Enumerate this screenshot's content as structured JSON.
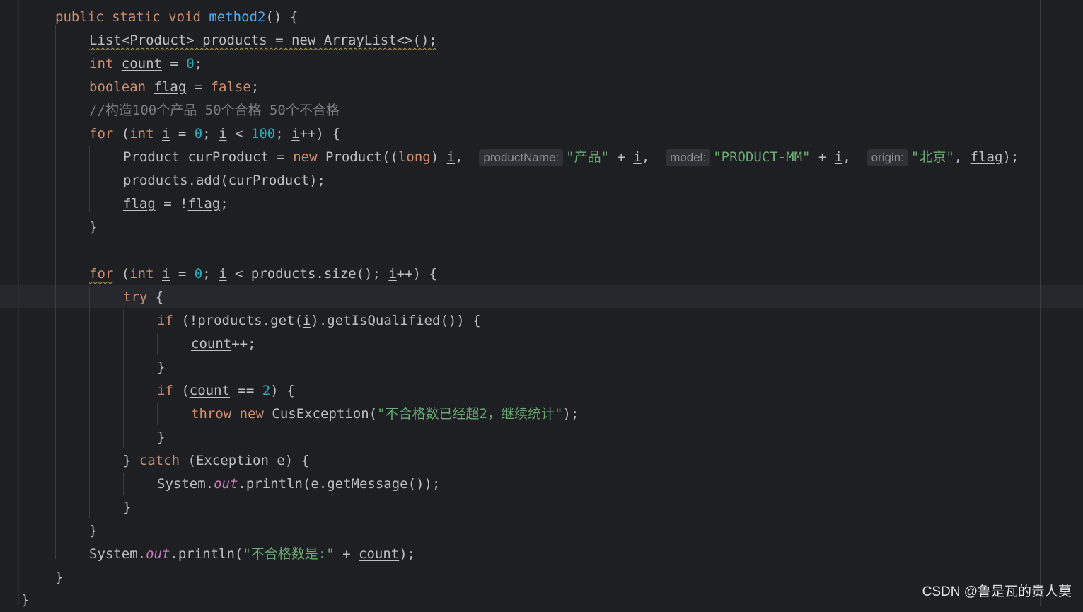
{
  "editor": {
    "lines": [
      {
        "t": [
          [
            "kw",
            "public static void "
          ],
          [
            "fn",
            "method2"
          ],
          [
            "",
            "() {"
          ]
        ]
      },
      {
        "t": [
          [
            "warn",
            "List<Product> products = new ArrayList<>();"
          ]
        ]
      },
      {
        "t": [
          [
            "kw",
            "int "
          ],
          [
            "var-mut",
            "count"
          ],
          [
            "",
            " = "
          ],
          [
            "num",
            "0"
          ],
          [
            "",
            ";"
          ]
        ]
      },
      {
        "t": [
          [
            "kw",
            "boolean "
          ],
          [
            "var-mut",
            "flag"
          ],
          [
            "",
            " = "
          ],
          [
            "kw",
            "false"
          ],
          [
            "",
            ";"
          ]
        ]
      },
      {
        "t": [
          [
            "cmt",
            "//构造100个产品 50个合格 50个不合格"
          ]
        ]
      },
      {
        "t": [
          [
            "kw",
            "for "
          ],
          [
            "",
            "("
          ],
          [
            "kw",
            "int "
          ],
          [
            "var-mut",
            "i"
          ],
          [
            "",
            " = "
          ],
          [
            "num",
            "0"
          ],
          [
            "",
            "; "
          ],
          [
            "var-mut",
            "i"
          ],
          [
            "",
            " < "
          ],
          [
            "num",
            "100"
          ],
          [
            "",
            "; "
          ],
          [
            "var-mut",
            "i"
          ],
          [
            "",
            "++) {"
          ]
        ]
      },
      {
        "t": [
          [
            "",
            "Product curProduct = "
          ],
          [
            "kw",
            "new "
          ],
          [
            "",
            "Product(("
          ],
          [
            "kw",
            "long"
          ],
          [
            "",
            ") "
          ],
          [
            "var-mut",
            "i"
          ],
          [
            "",
            ",  "
          ],
          [
            "hint",
            "productName:"
          ],
          [
            "str",
            "\"产品\""
          ],
          [
            "",
            " + "
          ],
          [
            "var-mut",
            "i"
          ],
          [
            "",
            ",  "
          ],
          [
            "hint",
            "model:"
          ],
          [
            "str",
            "\"PRODUCT-MM\""
          ],
          [
            "",
            " + "
          ],
          [
            "var-mut",
            "i"
          ],
          [
            "",
            ",  "
          ],
          [
            "hint",
            "origin:"
          ],
          [
            "str",
            "\"北京\""
          ],
          [
            "",
            ", "
          ],
          [
            "var-mut",
            "flag"
          ],
          [
            "",
            ");"
          ]
        ]
      },
      {
        "t": [
          [
            "",
            "products.add(curProduct);"
          ]
        ]
      },
      {
        "t": [
          [
            "var-mut",
            "flag"
          ],
          [
            "",
            " = !"
          ],
          [
            "var-mut",
            "flag"
          ],
          [
            "",
            ";"
          ]
        ]
      },
      {
        "t": [
          [
            "",
            "}"
          ]
        ]
      },
      {
        "t": []
      },
      {
        "t": [
          [
            "kw warn",
            "for"
          ],
          [
            "",
            " ("
          ],
          [
            "kw",
            "int "
          ],
          [
            "var-mut",
            "i"
          ],
          [
            "",
            " = "
          ],
          [
            "num",
            "0"
          ],
          [
            "",
            "; "
          ],
          [
            "var-mut",
            "i"
          ],
          [
            "",
            " < products.size(); "
          ],
          [
            "var-mut",
            "i"
          ],
          [
            "",
            "++) {"
          ]
        ]
      },
      {
        "t": [
          [
            "kw",
            "try "
          ],
          [
            "",
            "{"
          ]
        ]
      },
      {
        "t": [
          [
            "kw",
            "if "
          ],
          [
            "",
            "(!products.get("
          ],
          [
            "var-mut",
            "i"
          ],
          [
            "",
            ").getIsQualified()) {"
          ]
        ]
      },
      {
        "t": [
          [
            "var-mut",
            "count"
          ],
          [
            "",
            "++;"
          ]
        ]
      },
      {
        "t": [
          [
            "",
            "}"
          ]
        ]
      },
      {
        "t": [
          [
            "kw",
            "if "
          ],
          [
            "",
            "("
          ],
          [
            "var-mut",
            "count"
          ],
          [
            "",
            " == "
          ],
          [
            "num",
            "2"
          ],
          [
            "",
            ") {"
          ]
        ]
      },
      {
        "t": [
          [
            "kw",
            "throw new "
          ],
          [
            "",
            "CusException("
          ],
          [
            "str",
            "\"不合格数已经超2，继续统计\""
          ],
          [
            "",
            ");"
          ]
        ]
      },
      {
        "t": [
          [
            "",
            "}"
          ]
        ]
      },
      {
        "t": [
          [
            "",
            "} "
          ],
          [
            "kw",
            "catch "
          ],
          [
            "",
            "(Exception e) {"
          ]
        ]
      },
      {
        "t": [
          [
            "",
            "System."
          ],
          [
            "static-field",
            "out"
          ],
          [
            "",
            ".println(e.getMessage());"
          ]
        ]
      },
      {
        "t": [
          [
            "",
            "}"
          ]
        ]
      },
      {
        "t": [
          [
            "",
            "}"
          ]
        ]
      },
      {
        "t": [
          [
            "",
            "System."
          ],
          [
            "static-field",
            "out"
          ],
          [
            "",
            ".println("
          ],
          [
            "str",
            "\"不合格数是:\""
          ],
          [
            "",
            " + "
          ],
          [
            "var-mut",
            "count"
          ],
          [
            "",
            ");"
          ]
        ]
      },
      {
        "t": [
          [
            "",
            "}"
          ]
        ]
      },
      {
        "t": [
          [
            "",
            "}"
          ]
        ]
      }
    ]
  },
  "watermark": "CSDN @鲁是瓦的贵人莫"
}
